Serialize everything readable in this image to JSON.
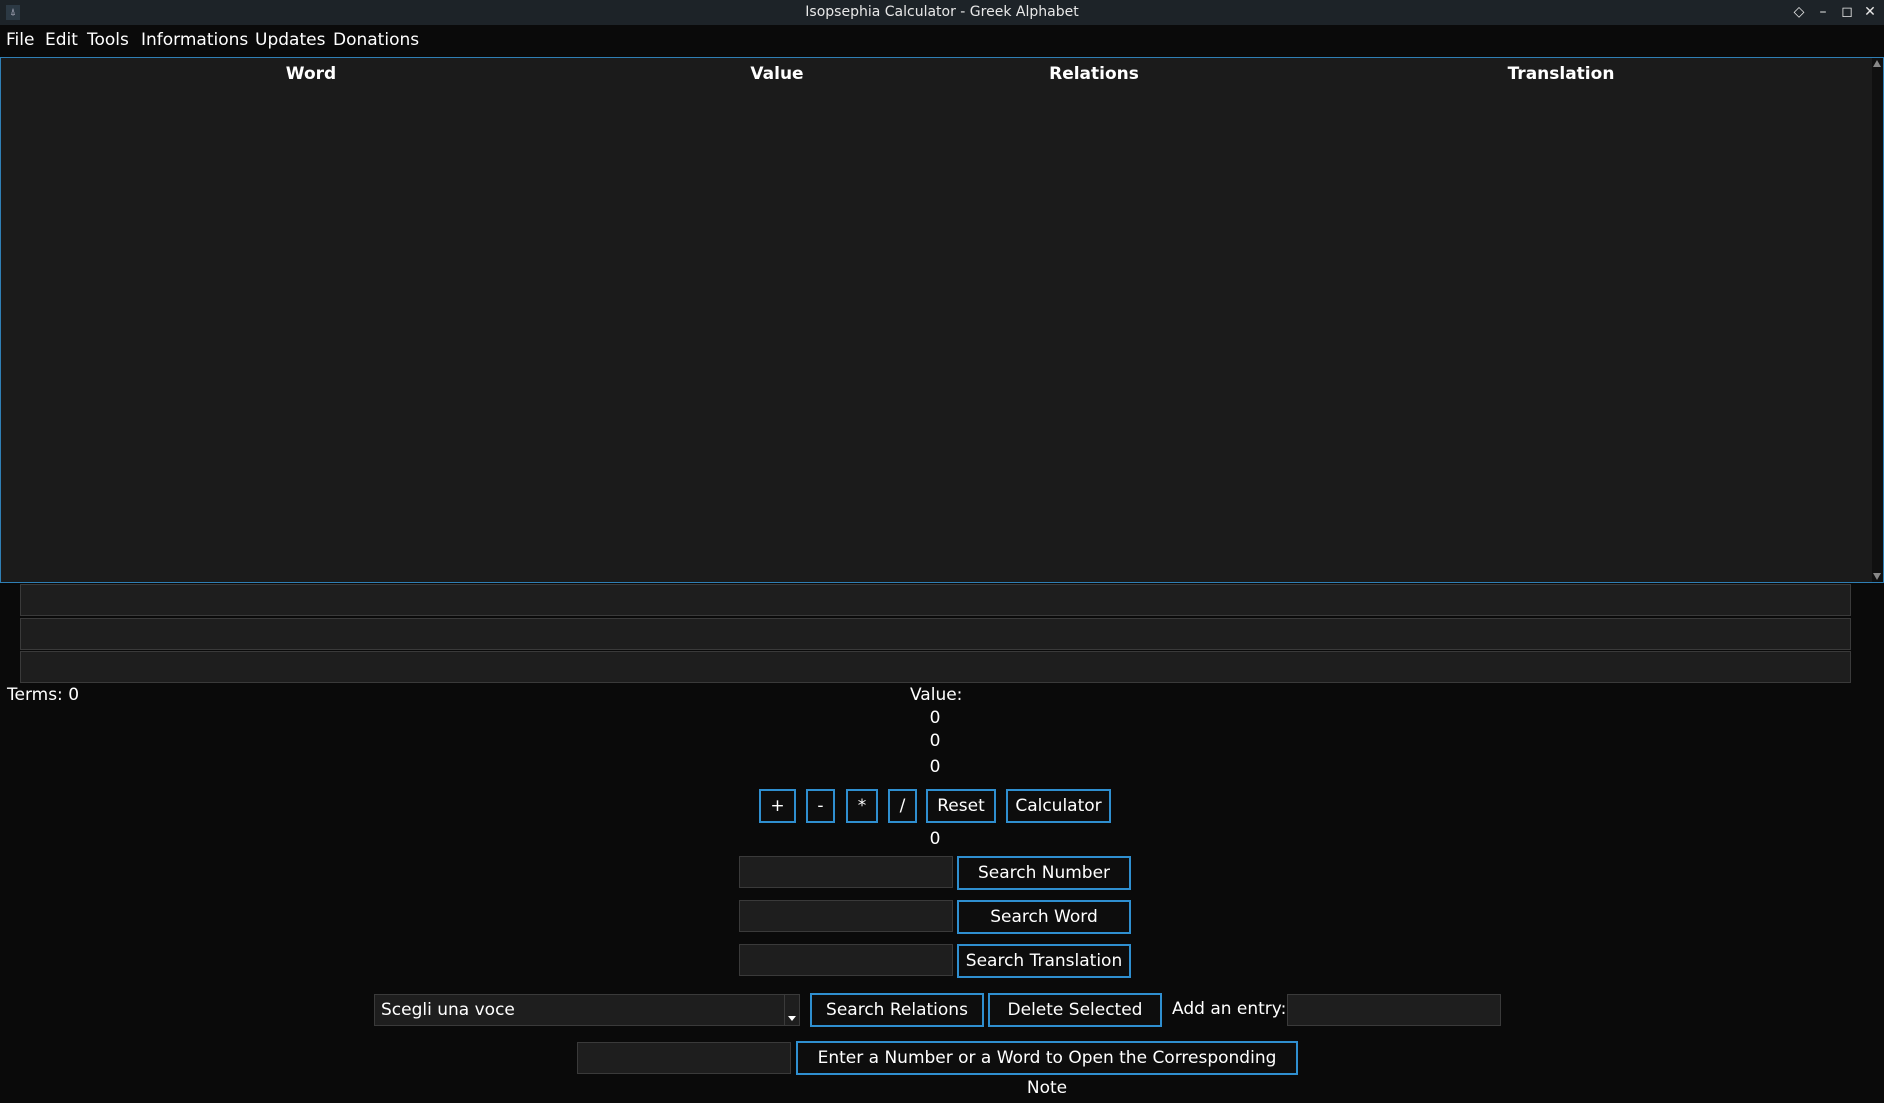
{
  "window": {
    "title": "Isopsephia Calculator - Greek Alphabet",
    "icons": [
      "app-icon",
      "pin-icon",
      "minimize-icon",
      "maximize-icon",
      "close-icon"
    ]
  },
  "menu": {
    "items": [
      "File",
      "Edit",
      "Tools",
      "Informations",
      "Updates",
      "Donations"
    ]
  },
  "table": {
    "columns": [
      "Word",
      "Value",
      "Relations",
      "Translation"
    ],
    "rows": []
  },
  "status": {
    "terms": "Terms: 0",
    "value_label": "Value:",
    "value1": "0",
    "value2": "0",
    "value3": "0",
    "result": "0"
  },
  "operators": {
    "plus": "+",
    "minus": "-",
    "multiply": "*",
    "divide": "/",
    "reset": "Reset",
    "calculator": "Calculator"
  },
  "search": {
    "number_button": "Search Number",
    "word_button": "Search Word",
    "translation_button": "Search Translation",
    "relations_button": "Search Relations",
    "delete_button": "Delete Selected"
  },
  "combo": {
    "selected": "Scegli una voce"
  },
  "entry": {
    "label": "Add an entry:"
  },
  "note": {
    "button": "Enter a Number or a Word to Open the Corresponding Note"
  },
  "colors": {
    "accent": "#2f8fd0",
    "background": "#0a0a0a",
    "panel": "#1b1b1b"
  }
}
